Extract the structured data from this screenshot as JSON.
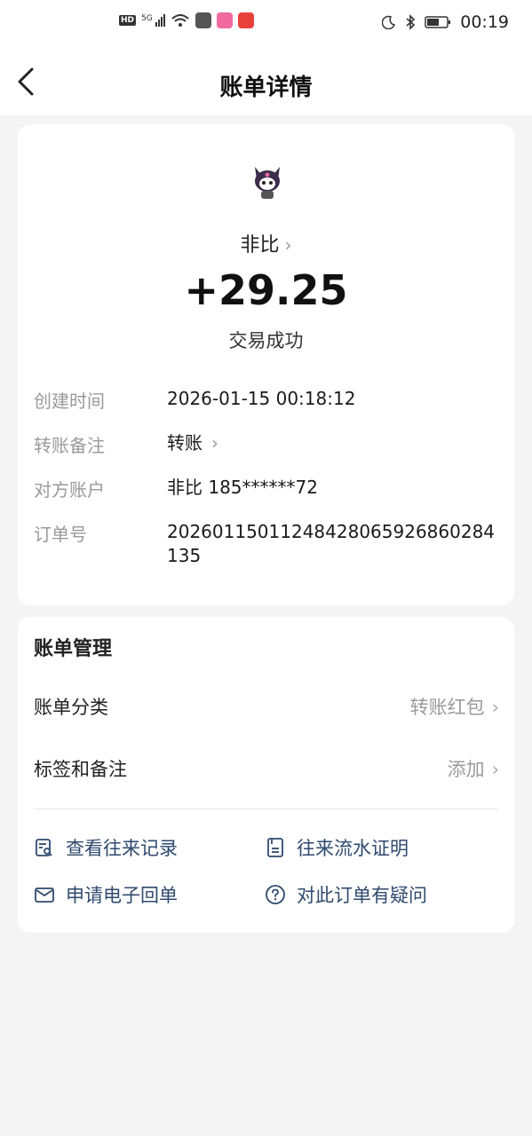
{
  "status_bar": {
    "signal_label": "5G",
    "hd_label": "HD",
    "time": "00:19"
  },
  "header": {
    "title": "账单详情"
  },
  "transaction": {
    "payee_name": "非比",
    "amount": "+29.25",
    "status": "交易成功",
    "details": [
      {
        "label": "创建时间",
        "value": "2026-01-15 00:18:12"
      },
      {
        "label": "转账备注",
        "value": "转账"
      },
      {
        "label": "对方账户",
        "value": "非比 185******72"
      },
      {
        "label": "订单号",
        "value": "20260115011248428065926860284135"
      }
    ]
  },
  "bill_management": {
    "title": "账单管理",
    "category_label": "账单分类",
    "category_value": "转账红包",
    "tags_label": "标签和备注",
    "tags_value": "添加",
    "actions": {
      "history": "查看往来记录",
      "statement": "往来流水证明",
      "receipt": "申请电子回单",
      "question": "对此订单有疑问"
    }
  },
  "colors": {
    "background": "#f4f4f4",
    "card": "#ffffff",
    "action_text": "#2f4a6e",
    "muted_text": "#9a9a9a"
  }
}
